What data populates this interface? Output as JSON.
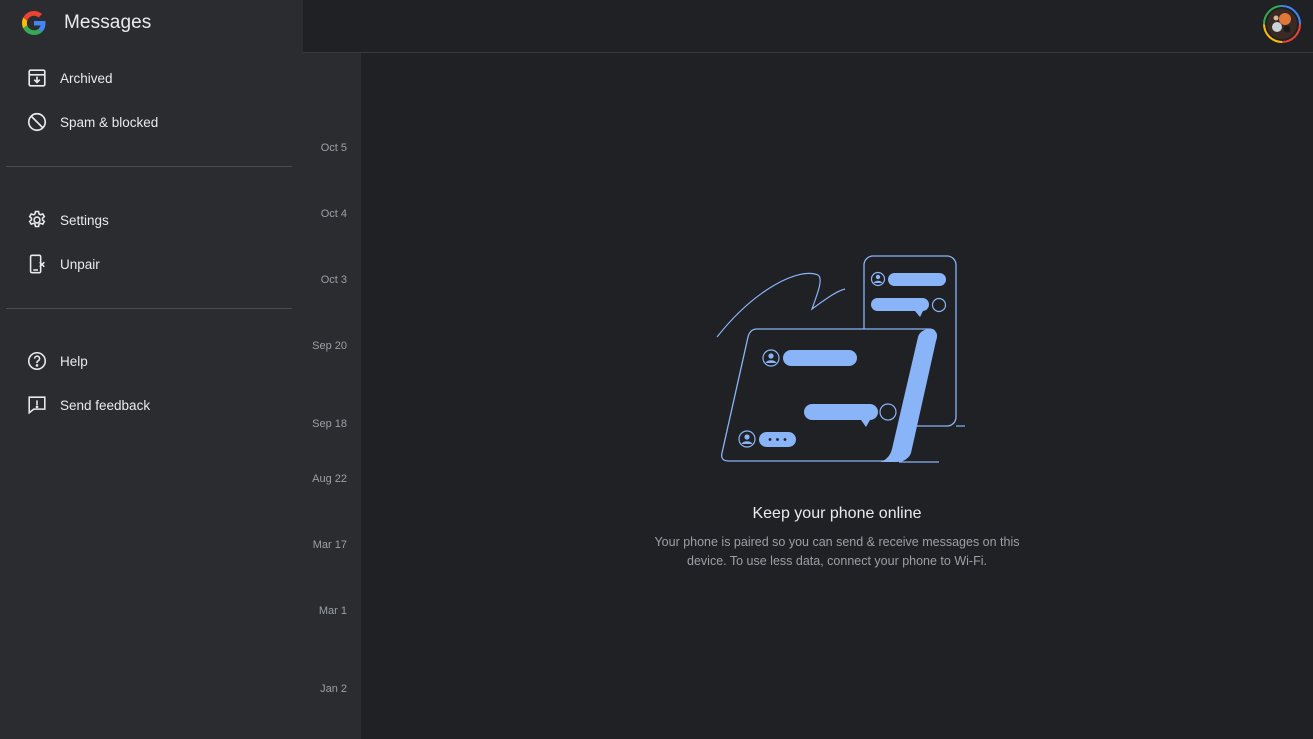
{
  "app": {
    "title": "Messages"
  },
  "drawer": {
    "items": [
      {
        "label": "Archived",
        "icon": "archive-icon"
      },
      {
        "label": "Spam & blocked",
        "icon": "block-icon"
      },
      {
        "label": "Settings",
        "icon": "gear-icon"
      },
      {
        "label": "Unpair",
        "icon": "unpair-device-icon"
      },
      {
        "label": "Help",
        "icon": "help-circle-icon"
      },
      {
        "label": "Send feedback",
        "icon": "feedback-icon"
      }
    ]
  },
  "conversation_dates": [
    "Oct 5",
    "Oct 4",
    "Oct 3",
    "Sep 20",
    "Sep 18",
    "Aug 22",
    "Mar 17",
    "Mar 1",
    "Jan 2"
  ],
  "empty_state": {
    "title": "Keep your phone online",
    "body": "Your phone is paired so you can send & receive messages on this device. To use less data, connect your phone to Wi-Fi."
  },
  "colors": {
    "background": "#202124",
    "drawer": "#2b2c2f",
    "accent": "#8ab4f8",
    "text_primary": "#e8eaed",
    "text_secondary": "#9aa0a6"
  }
}
